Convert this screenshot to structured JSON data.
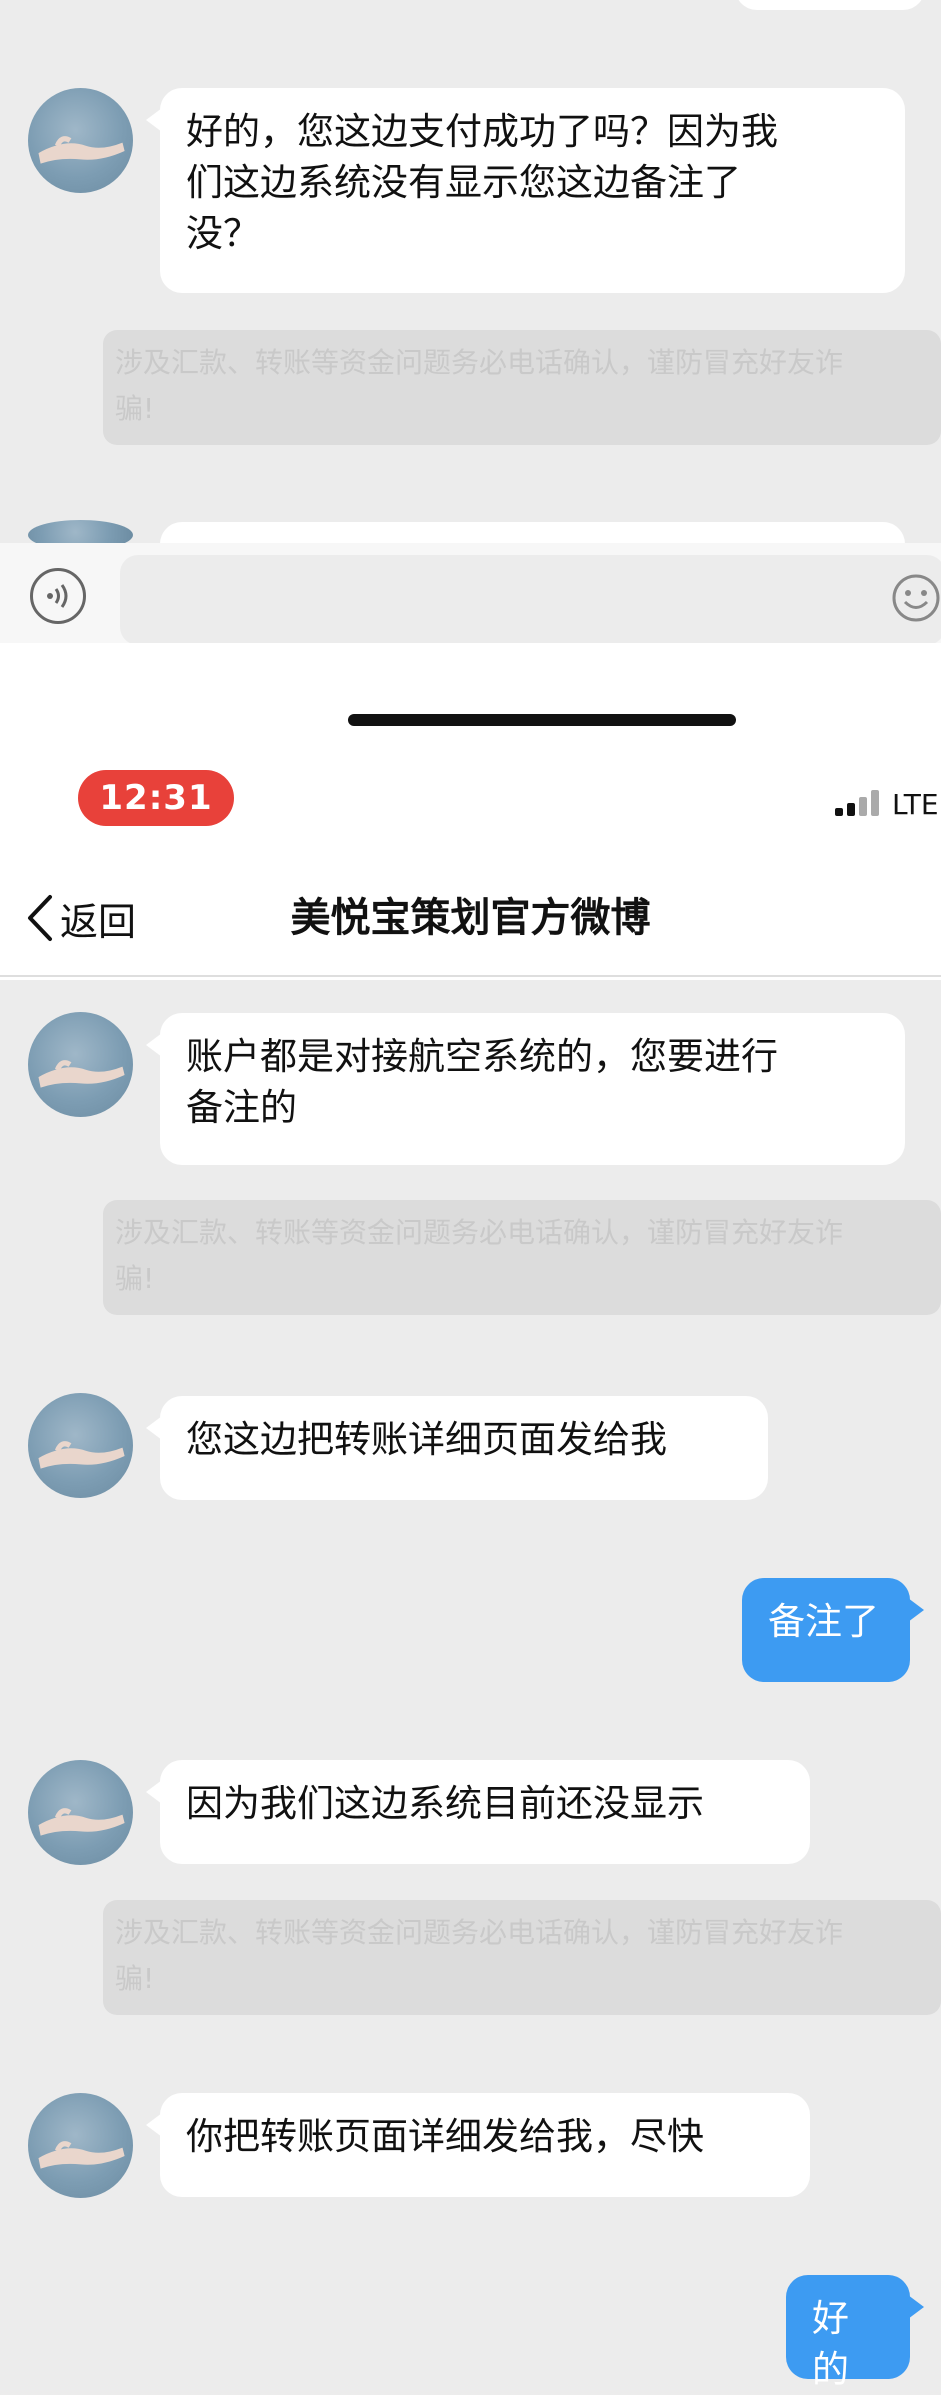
{
  "chat": {
    "title": "美悦宝策划官方微博",
    "back_label": "返回",
    "warning_lines": [
      "涉及汇款、转账等资金问题务必电话确认，谨防冒充好友诈",
      "骗!"
    ],
    "messages": [
      {
        "side": "left",
        "lines": [
          "好的，您这边支付成功了吗？因为我",
          "们这边系统没有显示您这边备注了",
          "没？"
        ]
      },
      {
        "side": "left",
        "lines": [
          "账户都是对接航空系统的，您要进行",
          "备注的"
        ]
      },
      {
        "side": "left",
        "lines": [
          "您这边把转账详细页面发给我"
        ]
      },
      {
        "side": "right",
        "lines": [
          "备注了"
        ]
      },
      {
        "side": "left",
        "lines": [
          "因为我们这边系统目前还没显示"
        ]
      },
      {
        "side": "left",
        "lines": [
          "你把转账页面详细发给我，尽快"
        ]
      },
      {
        "side": "right",
        "lines": [
          "好的"
        ]
      }
    ]
  },
  "status_bar": {
    "time": "12:31",
    "network": "LTE"
  },
  "icons": {
    "voice": "voice-icon",
    "emoji": "emoji-icon",
    "back": "chevron-left-icon",
    "signal": "signal-icon"
  },
  "colors": {
    "self_bubble": "#3d9bf2",
    "time_pill": "#e8413a"
  }
}
